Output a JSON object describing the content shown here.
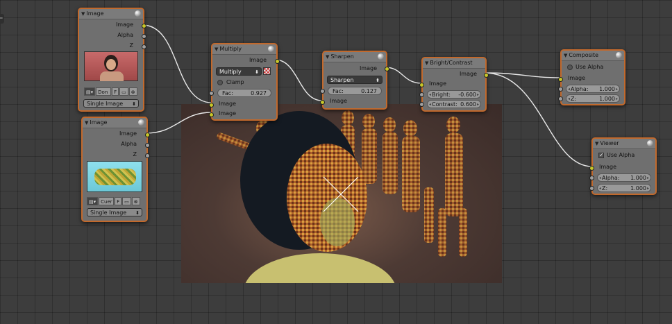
{
  "colors": {
    "node_border": "#c2692c",
    "socket_image": "#c7c729",
    "socket_value": "#a0a0a0",
    "canvas": "#3d3d3d"
  },
  "image_node_1": {
    "title": "Image",
    "out_image": "Image",
    "out_alpha": "Alpha",
    "out_z": "Z",
    "file_name": "Don",
    "fake_user": "F",
    "source": "Single Image"
  },
  "image_node_2": {
    "title": "Image",
    "out_image": "Image",
    "out_alpha": "Alpha",
    "out_z": "Z",
    "file_name": "Cuer",
    "fake_user": "F",
    "source": "Single Image"
  },
  "multiply_node": {
    "title": "Multiply",
    "out_image": "Image",
    "blend_mode": "Multiply",
    "clamp_label": "Clamp",
    "fac_label": "Fac:",
    "fac_value": "0.927",
    "in_image_1": "Image",
    "in_image_2": "Image"
  },
  "sharpen_node": {
    "title": "Sharpen",
    "out_image": "Image",
    "filter_type": "Sharpen",
    "fac_label": "Fac:",
    "fac_value": "0.127",
    "in_image": "Image"
  },
  "bright_node": {
    "title": "Bright/Contrast",
    "out_image": "Image",
    "in_image": "Image",
    "bright_label": "Bright:",
    "bright_value": "-0.600",
    "contrast_label": "Contrast:",
    "contrast_value": "0.600"
  },
  "composite_node": {
    "title": "Composite",
    "use_alpha_label": "Use Alpha",
    "use_alpha_checked": false,
    "in_image": "Image",
    "alpha_label": "Alpha:",
    "alpha_value": "1.000",
    "z_label": "Z:",
    "z_value": "1.000"
  },
  "viewer_node": {
    "title": "Viewer",
    "use_alpha_label": "Use Alpha",
    "use_alpha_checked": true,
    "in_image": "Image",
    "alpha_label": "Alpha:",
    "alpha_value": "1.000",
    "z_label": "Z:",
    "z_value": "1.000"
  }
}
